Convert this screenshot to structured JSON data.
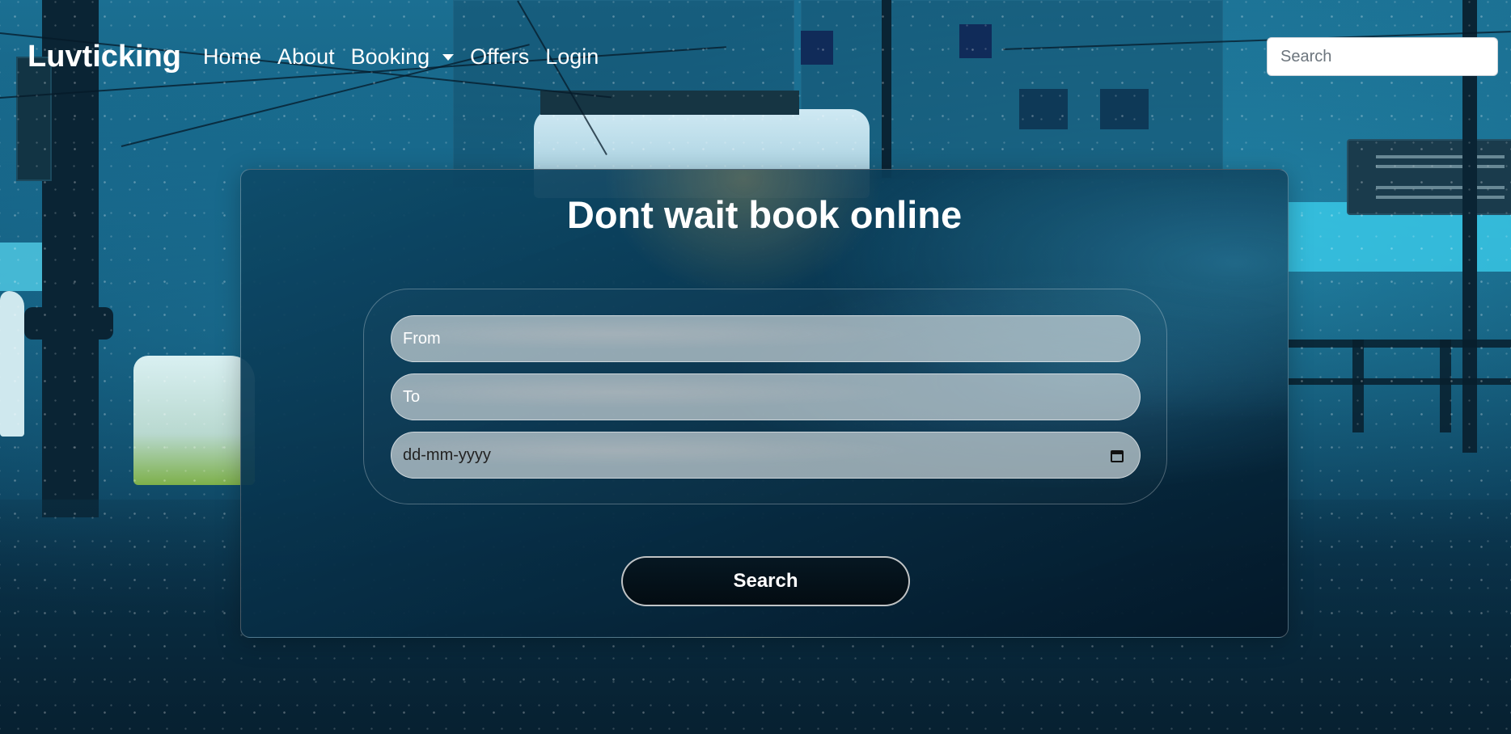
{
  "navbar": {
    "brand": "Luvticking",
    "links": [
      {
        "label": "Home"
      },
      {
        "label": "About"
      },
      {
        "label": "Booking",
        "has_dropdown": true
      },
      {
        "label": "Offers"
      },
      {
        "label": "Login"
      }
    ],
    "search": {
      "placeholder": "Search",
      "value": ""
    }
  },
  "booking": {
    "title": "Dont wait book online",
    "from": {
      "placeholder": "From",
      "value": ""
    },
    "to": {
      "placeholder": "To",
      "value": ""
    },
    "date": {
      "placeholder": "dd-mm-yyyy",
      "value": "",
      "icon": "calendar-icon"
    },
    "search_label": "Search"
  },
  "colors": {
    "card_border": "#ffffff47",
    "button_bg": "#040f17",
    "text": "#ffffff"
  },
  "icons": [
    "chevron-down-icon",
    "calendar-icon"
  ]
}
